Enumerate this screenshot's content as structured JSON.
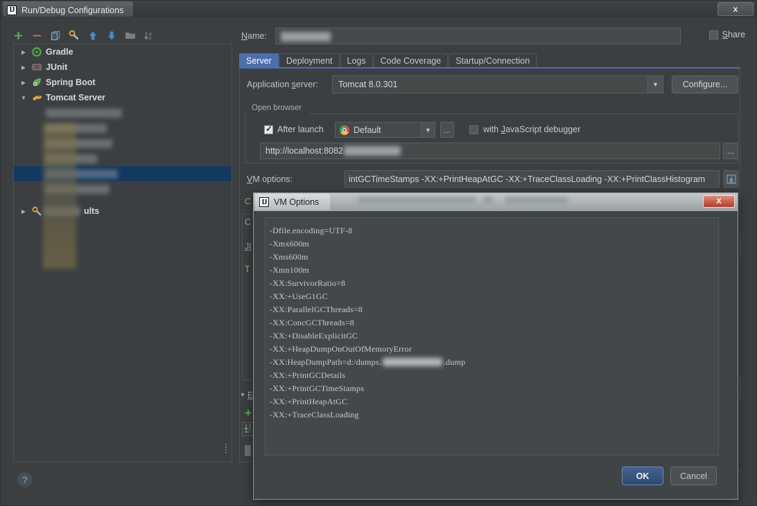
{
  "window": {
    "title": "Run/Debug Configurations",
    "logo": "IJ",
    "close_label": "x"
  },
  "toolbar": {
    "items": [
      {
        "name": "add-icon",
        "glyph": "+"
      },
      {
        "name": "remove-icon",
        "glyph": "−"
      },
      {
        "name": "copy-icon",
        "glyph": "❐"
      },
      {
        "name": "edit-templates-icon",
        "glyph": "⚒"
      },
      {
        "name": "move-up-icon",
        "glyph": "↑"
      },
      {
        "name": "move-down-icon",
        "glyph": "↓"
      },
      {
        "name": "folder-icon",
        "glyph": "▬"
      },
      {
        "name": "sort-alphabetically-icon",
        "glyph": "↓"
      }
    ]
  },
  "tree": {
    "items": [
      {
        "label": "Gradle",
        "expanded": false,
        "icon": "gradle-icon",
        "selected": false,
        "blurred": false
      },
      {
        "label": "JUnit",
        "expanded": false,
        "icon": "junit-icon",
        "selected": false,
        "blurred": false
      },
      {
        "label": "Spring Boot",
        "expanded": false,
        "icon": "spring-boot-icon",
        "selected": false,
        "blurred": false
      },
      {
        "label": "Tomcat Server",
        "expanded": true,
        "icon": "tomcat-icon",
        "selected": false,
        "blurred": false
      },
      {
        "label": "",
        "expanded": null,
        "icon": "",
        "selected": false,
        "blurred": true
      },
      {
        "label": "",
        "expanded": null,
        "icon": "",
        "selected": false,
        "blurred": true
      },
      {
        "label": "",
        "expanded": null,
        "icon": "",
        "selected": false,
        "blurred": true
      },
      {
        "label": "",
        "expanded": null,
        "icon": "",
        "selected": true,
        "blurred": true
      },
      {
        "label": "",
        "expanded": null,
        "icon": "",
        "selected": false,
        "blurred": true
      },
      {
        "label": "ults",
        "expanded": false,
        "icon": "defaults-icon",
        "selected": false,
        "blurred": true
      }
    ]
  },
  "help_button": {
    "label": "?"
  },
  "form": {
    "name_label": "Name:",
    "name_value": "",
    "share_label": "Share",
    "share_checked": false
  },
  "tabs": [
    {
      "label": "Server",
      "active": true
    },
    {
      "label": "Deployment",
      "active": false
    },
    {
      "label": "Logs",
      "active": false
    },
    {
      "label": "Code Coverage",
      "active": false
    },
    {
      "label": "Startup/Connection",
      "active": false
    }
  ],
  "server_tab": {
    "application_server_label": "Application server:",
    "application_server_value": "Tomcat 8.0.301",
    "configure_button": "Configure...",
    "open_browser_legend": "Open browser",
    "after_launch_label": "After launch",
    "after_launch_checked": true,
    "browser_value": "Default",
    "browser_icon": "chrome-icon",
    "browser_ellipsis": "...",
    "js_debugger_label": "with JavaScript debugger",
    "js_debugger_checked": false,
    "url_value": "http://localhost:8082",
    "url_ellipsis": "...",
    "vm_options_label": "VM options:",
    "vm_options_value": "intGCTimeStamps -XX:+PrintHeapAtGC -XX:+TraceClassLoading -XX:+PrintClassHistogram",
    "vm_expand_icon": "expand-editor-icon"
  },
  "background_fragments": {
    "left_labels": [
      "C",
      "C",
      "JI",
      "T",
      "E"
    ],
    "right_label": "e"
  },
  "vm_modal": {
    "title": "VM Options",
    "logo": "IJ",
    "close_label": "X",
    "lines": [
      {
        "text": "-Dfile.encoding=UTF-8",
        "has_blur": false,
        "suffix": ""
      },
      {
        "text": "-Xmx600m",
        "has_blur": false,
        "suffix": ""
      },
      {
        "text": "-Xms600m",
        "has_blur": false,
        "suffix": ""
      },
      {
        "text": "-Xmn100m",
        "has_blur": false,
        "suffix": ""
      },
      {
        "text": "-XX:SurvivorRatio=8",
        "has_blur": false,
        "suffix": ""
      },
      {
        "text": "-XX:+UseG1GC",
        "has_blur": false,
        "suffix": ""
      },
      {
        "text": "-XX:ParallelGCThreads=8",
        "has_blur": false,
        "suffix": ""
      },
      {
        "text": "-XX:ConcGCThreads=8",
        "has_blur": false,
        "suffix": ""
      },
      {
        "text": "-XX:+DisableExplicitGC",
        "has_blur": false,
        "suffix": ""
      },
      {
        "text": "-XX:+HeapDumpOnOutOfMemoryError",
        "has_blur": false,
        "suffix": ""
      },
      {
        "text": "-XX:HeapDumpPath=d:/dumps.",
        "has_blur": true,
        "suffix": ".dump"
      },
      {
        "text": "-XX:+PrintGCDetails",
        "has_blur": false,
        "suffix": ""
      },
      {
        "text": "-XX:+PrintGCTimeStamps",
        "has_blur": false,
        "suffix": ""
      },
      {
        "text": "-XX:+PrintHeapAtGC",
        "has_blur": false,
        "suffix": ""
      },
      {
        "text": "-XX:+TraceClassLoading",
        "has_blur": false,
        "suffix": ""
      }
    ],
    "ok_button": "OK",
    "cancel_button": "Cancel"
  },
  "colors": {
    "window_bg": "#3c3f41",
    "field_bg": "#45494a",
    "accent_blue": "#4b6eaf",
    "selection_blue": "#13395e",
    "text": "#d4d8da",
    "close_red": "#b8392a"
  }
}
